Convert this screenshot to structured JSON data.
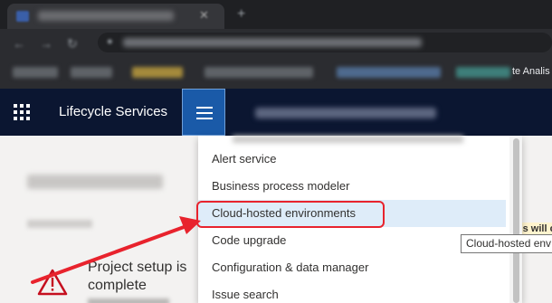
{
  "header": {
    "app_title": "Lifecycle Services"
  },
  "menu": {
    "items": [
      {
        "label": "Alert service"
      },
      {
        "label": "Business process modeler"
      },
      {
        "label": "Cloud-hosted environments"
      },
      {
        "label": "Code upgrade"
      },
      {
        "label": "Configuration & data manager"
      },
      {
        "label": "Issue search"
      }
    ],
    "selected_index": 2
  },
  "tooltip": {
    "text": "Cloud-hosted env"
  },
  "page": {
    "setup_message": "Project setup is complete"
  },
  "bookmarks": {
    "visible_label": "te Analis"
  },
  "colors": {
    "header_bg": "#0b1631",
    "menu_button_bg": "#1a5aa8",
    "selected_item_bg": "#deecf9",
    "annotation_red": "#e8232d",
    "warning_icon": "#c50f1f"
  }
}
